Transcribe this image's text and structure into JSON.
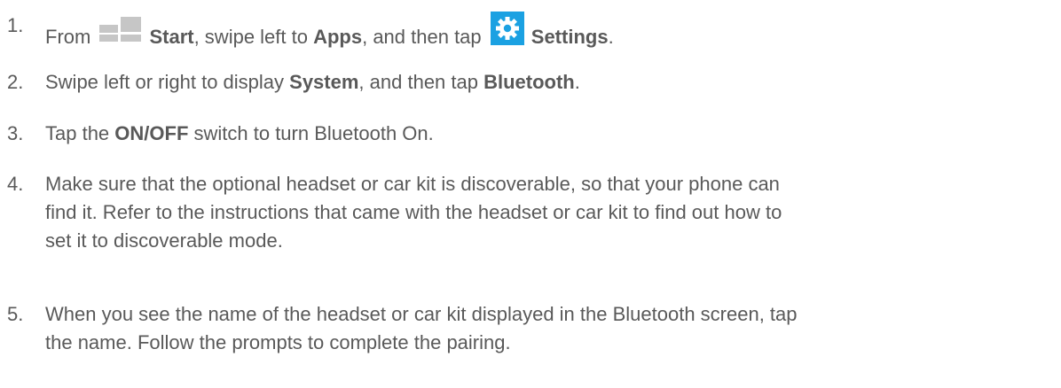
{
  "steps": [
    {
      "number": "1.",
      "text": {
        "a": "From ",
        "start_icon": "windows-start-icon",
        "b": "Start",
        "c": ", swipe left to ",
        "d": "Apps",
        "e": ", and then tap ",
        "settings_icon": "settings-gear-icon",
        "f": "Settings",
        "g": "."
      }
    },
    {
      "number": "2.",
      "text": {
        "a": "Swipe left or right to display ",
        "b": "System",
        "c": ", and then tap ",
        "d": "Bluetooth",
        "e": "."
      }
    },
    {
      "number": "3.",
      "text": {
        "a": "Tap the ",
        "b": "ON/OFF",
        "c": " switch to turn Bluetooth On."
      }
    },
    {
      "number": "4.",
      "text": {
        "line1": "Make sure that the optional headset or car kit is discoverable, so that your phone can",
        "line2": "find it. Refer to the instructions that came with the headset or car kit to find out how to",
        "line3": "set it to discoverable mode."
      }
    },
    {
      "number": "5.",
      "text": {
        "line1": "When you see the name of the headset or car kit displayed in the Bluetooth screen, tap",
        "line2": "the name. Follow the prompts to complete the pairing."
      }
    }
  ],
  "colors": {
    "text": "#595959",
    "start_tile": "#c6c6c6",
    "settings_tile": "#1ba1e2"
  }
}
